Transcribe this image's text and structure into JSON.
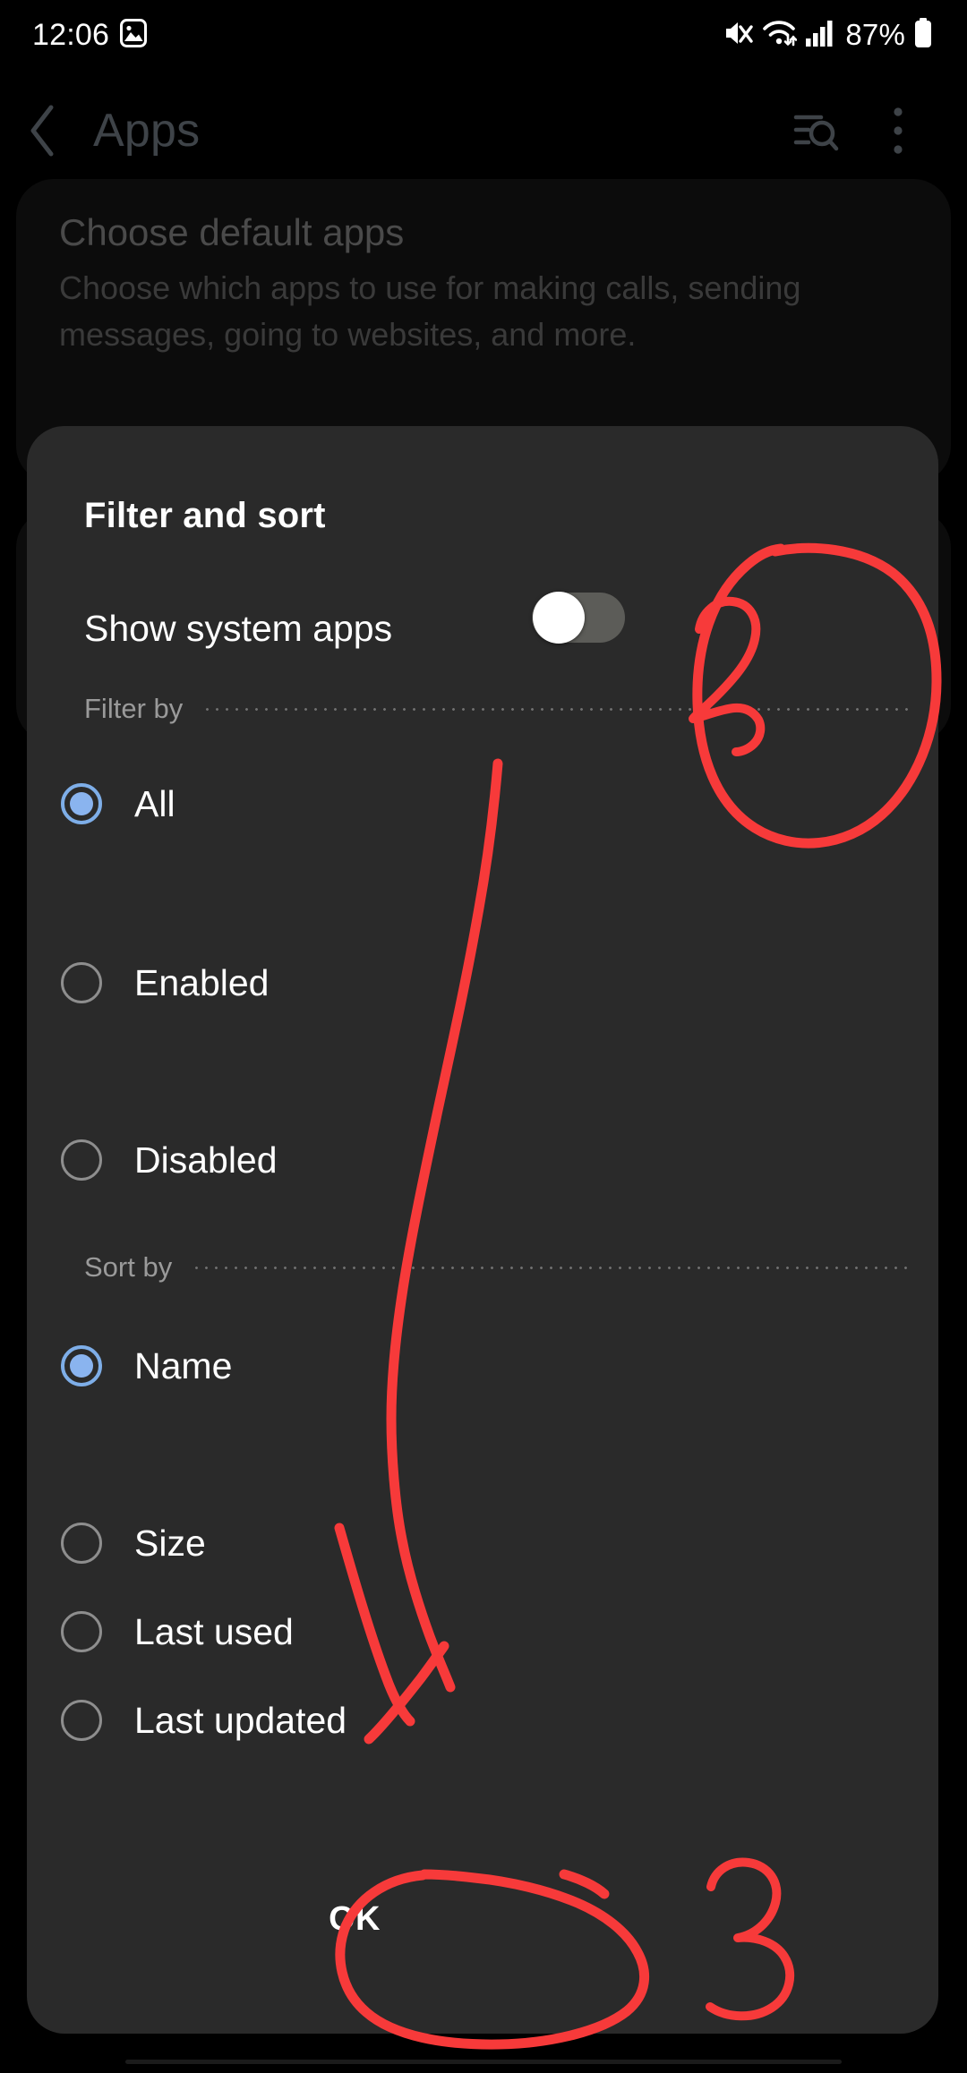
{
  "status_bar": {
    "time": "12:06",
    "left_icons": [
      "image-icon"
    ],
    "right_icons": [
      "mute-icon",
      "wifi-icon",
      "signal-icon"
    ],
    "battery_percent": "87%"
  },
  "header": {
    "back_label": "back-icon",
    "title": "Apps",
    "actions": [
      "search-filter-icon",
      "more-options-icon"
    ]
  },
  "background": {
    "card_title": "Choose default apps",
    "card_desc": "Choose which apps to use for making calls, sending messages, going to websites, and more."
  },
  "dialog": {
    "title": "Filter and sort",
    "show_system_apps": {
      "label": "Show system apps",
      "state": "off"
    },
    "filter_section": {
      "label": "Filter by",
      "options": [
        {
          "label": "All",
          "selected": true
        },
        {
          "label": "Enabled",
          "selected": false
        },
        {
          "label": "Disabled",
          "selected": false
        }
      ]
    },
    "sort_section": {
      "label": "Sort by",
      "options": [
        {
          "label": "Name",
          "selected": true
        },
        {
          "label": "Size",
          "selected": false
        },
        {
          "label": "Last used",
          "selected": false
        },
        {
          "label": "Last updated",
          "selected": false
        }
      ]
    },
    "ok_label": "OK"
  },
  "annotations": {
    "color": "#f73a3a",
    "marks": [
      {
        "name": "circle-around-toggle",
        "type": "ellipse"
      },
      {
        "name": "handwritten-2",
        "type": "text",
        "text": "2"
      },
      {
        "name": "arrow-to-ok",
        "type": "arrow"
      },
      {
        "name": "circle-around-ok",
        "type": "ellipse"
      },
      {
        "name": "handwritten-3",
        "type": "text",
        "text": "3"
      }
    ]
  },
  "colors": {
    "dialog_bg": "#2a2a2a",
    "accent_radio": "#8ab4ef",
    "annotation_red": "#f73a3a",
    "page_bg": "#000000"
  }
}
